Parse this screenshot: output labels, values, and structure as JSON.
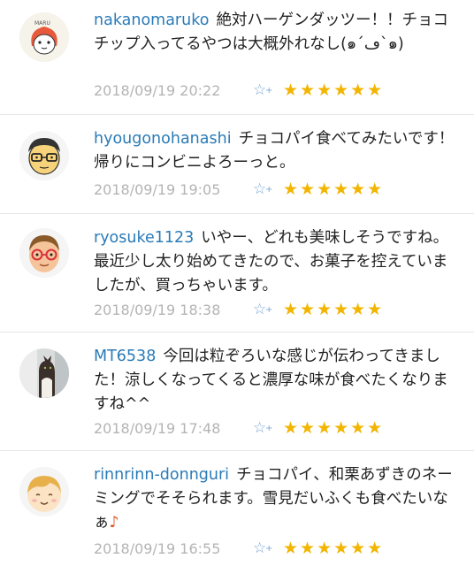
{
  "comments": [
    {
      "username": "nakanomaruko",
      "text": "絶対ハーゲンダッツー！！チョコチップ入ってるやつは大概外れなし(๑´ڡ`๑)",
      "date": "2018/09/19 20:22",
      "rating": "★★★★★★",
      "avatar_icon": "maru-character-icon"
    },
    {
      "username": "hyougonohanashi",
      "text": "チョコパイ食べてみたいです！帰りにコンビニよろーっと。",
      "date": "2018/09/19 19:05",
      "rating": "★★★★★★",
      "avatar_icon": "glasses-man-icon"
    },
    {
      "username": "ryosuke1123",
      "text": "いやー、どれも美味しそうですね。最近少し太り始めてきたので、お菓子を控えていましたが、買っちゃいます。",
      "date": "2018/09/19 18:38",
      "rating": "★★★★★★",
      "avatar_icon": "red-glasses-man-icon"
    },
    {
      "username": "MT6538",
      "text": "今回は粒ぞろいな感じが伝わってきました！涼しくなってくると濃厚な味が食べたくなりますね^^",
      "date": "2018/09/19 17:48",
      "rating": "★★★★★★",
      "avatar_icon": "cat-photo-icon"
    },
    {
      "username": "rinnrinn-donnguri",
      "text": "チョコパイ、和栗あずきのネーミングでそそられます。雪見だいふくも食べたいなぁ",
      "note": "♪",
      "date": "2018/09/19 16:55",
      "rating": "★★★★★★",
      "avatar_icon": "smiling-face-icon"
    }
  ],
  "favorite_icon": "star-outline-plus-icon",
  "colors": {
    "username": "#2a7bb8",
    "date": "#b4b4b4",
    "stars": "#f2b500",
    "favorite": "#7aa7d6",
    "note": "#e0562c"
  }
}
